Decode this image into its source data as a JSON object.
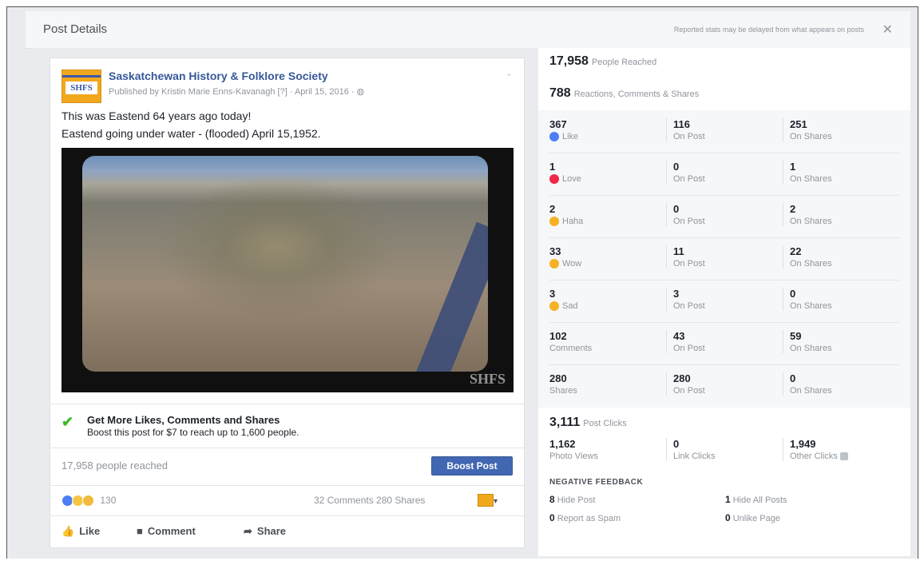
{
  "dialog": {
    "title": "Post Details",
    "note": "Reported stats may be delayed from what appears on posts",
    "close": "✕"
  },
  "post": {
    "logo_text": "SHFS",
    "page_name": "Saskatchewan History & Folklore Society",
    "published": "Published by Kristin Marie Enns-Kavanagh [?] · April 15, 2016 · ◍",
    "text_line1": "This was Eastend 64 years ago today!",
    "text_line2": "Eastend going under water - (flooded) April 15,1952.",
    "photo_watermark": "SHFS",
    "boost": {
      "title": "Get More Likes, Comments and Shares",
      "subtitle": "Boost this post for $7 to reach up to 1,600 people."
    },
    "reached_text": "17,958 people reached",
    "boost_button": "Boost Post",
    "reactions_count": "130",
    "comments_shares": "32 Comments  280 Shares",
    "actions": {
      "like": "Like",
      "comment": "Comment",
      "share": "Share"
    }
  },
  "insights": {
    "people_reached": {
      "value": "17,958",
      "label": "People Reached"
    },
    "engagement": {
      "value": "788",
      "label": "Reactions, Comments & Shares"
    },
    "rows": [
      {
        "total": "367",
        "name": "Like",
        "icon": "like-icon",
        "color": "#4d7ef4",
        "on_post": "116",
        "on_post_label": "On Post",
        "on_shares": "251",
        "on_shares_label": "On Shares"
      },
      {
        "total": "1",
        "name": "Love",
        "icon": "love-icon",
        "color": "#f0284a",
        "on_post": "0",
        "on_post_label": "On Post",
        "on_shares": "1",
        "on_shares_label": "On Shares"
      },
      {
        "total": "2",
        "name": "Haha",
        "icon": "haha-icon",
        "color": "#f7b125",
        "on_post": "0",
        "on_post_label": "On Post",
        "on_shares": "2",
        "on_shares_label": "On Shares"
      },
      {
        "total": "33",
        "name": "Wow",
        "icon": "wow-icon",
        "color": "#f7b125",
        "on_post": "11",
        "on_post_label": "On Post",
        "on_shares": "22",
        "on_shares_label": "On Shares"
      },
      {
        "total": "3",
        "name": "Sad",
        "icon": "sad-icon",
        "color": "#f7b125",
        "on_post": "3",
        "on_post_label": "On Post",
        "on_shares": "0",
        "on_shares_label": "On Shares"
      },
      {
        "total": "102",
        "name": "Comments",
        "icon": "",
        "color": "",
        "on_post": "43",
        "on_post_label": "On Post",
        "on_shares": "59",
        "on_shares_label": "On Shares"
      },
      {
        "total": "280",
        "name": "Shares",
        "icon": "",
        "color": "",
        "on_post": "280",
        "on_post_label": "On Post",
        "on_shares": "0",
        "on_shares_label": "On Shares"
      }
    ],
    "post_clicks": {
      "value": "3,111",
      "label": "Post Clicks"
    },
    "clicks": [
      {
        "value": "1,162",
        "label": "Photo Views"
      },
      {
        "value": "0",
        "label": "Link Clicks"
      },
      {
        "value": "1,949",
        "label": "Other Clicks"
      }
    ],
    "negative": {
      "title": "NEGATIVE FEEDBACK",
      "items": [
        {
          "value": "8",
          "label": "Hide Post"
        },
        {
          "value": "1",
          "label": "Hide All Posts"
        },
        {
          "value": "0",
          "label": "Report as Spam"
        },
        {
          "value": "0",
          "label": "Unlike Page"
        }
      ]
    }
  }
}
